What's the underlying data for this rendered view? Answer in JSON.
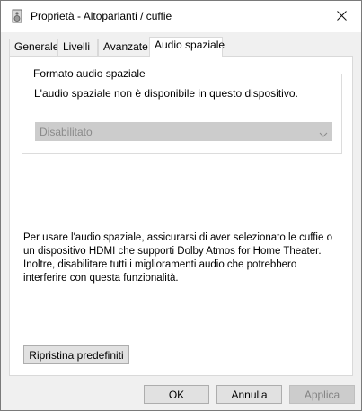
{
  "window": {
    "title": "Proprietà - Altoparlanti / cuffie",
    "icons": {
      "app": "speaker-icon",
      "close": "close-icon"
    }
  },
  "tabs": [
    {
      "label": "Generale",
      "active": false
    },
    {
      "label": "Livelli",
      "active": false
    },
    {
      "label": "Avanzate",
      "active": false
    },
    {
      "label": "Audio spaziale",
      "active": true
    }
  ],
  "spatial": {
    "group_label": "Formato audio spaziale",
    "message": "L'audio spaziale non è disponibile in questo dispositivo.",
    "format_select": {
      "value": "Disabilitato",
      "enabled": false,
      "icon": "chevron-down-icon"
    }
  },
  "info": {
    "text": "Per usare l'audio spaziale, assicurarsi di aver selezionato le cuffie o un dispositivo HDMI che supporti Dolby Atmos for Home Theater. Inoltre, disabilitare tutti i miglioramenti audio che potrebbero interferire con questa funzionalità."
  },
  "buttons": {
    "reset": "Ripristina predefiniti",
    "ok": "OK",
    "cancel": "Annulla",
    "apply": "Applica",
    "apply_enabled": false
  }
}
